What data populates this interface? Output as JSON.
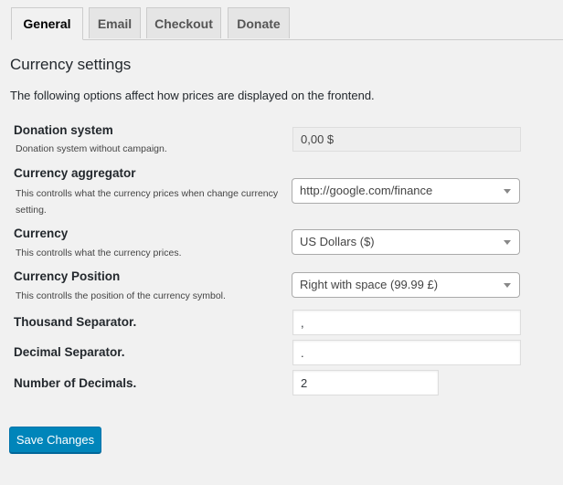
{
  "tabs": [
    {
      "label": "General",
      "active": true
    },
    {
      "label": "Email",
      "active": false
    },
    {
      "label": "Checkout",
      "active": false
    },
    {
      "label": "Donate",
      "active": false
    }
  ],
  "section": {
    "title": "Currency settings",
    "intro": "The following options affect how prices are displayed on the frontend."
  },
  "fields": {
    "donation_system": {
      "label": "Donation system",
      "description": "Donation system without campaign.",
      "value": "0,00 $"
    },
    "currency_aggregator": {
      "label": "Currency aggregator",
      "description": "This controlls what the currency prices when change currency setting.",
      "value": "http://google.com/finance"
    },
    "currency": {
      "label": "Currency",
      "description": "This controlls what the currency prices.",
      "value": "US Dollars ($)"
    },
    "currency_position": {
      "label": "Currency Position",
      "description": "This controlls the position of the currency symbol.",
      "value": "Right with space (99.99 £)"
    },
    "thousand_separator": {
      "label": "Thousand Separator.",
      "value": ","
    },
    "decimal_separator": {
      "label": "Decimal Separator.",
      "value": "."
    },
    "number_of_decimals": {
      "label": "Number of Decimals.",
      "value": "2"
    }
  },
  "actions": {
    "save_label": "Save Changes"
  },
  "colors": {
    "primary_button": "#0085ba",
    "background": "#f1f1f1"
  }
}
